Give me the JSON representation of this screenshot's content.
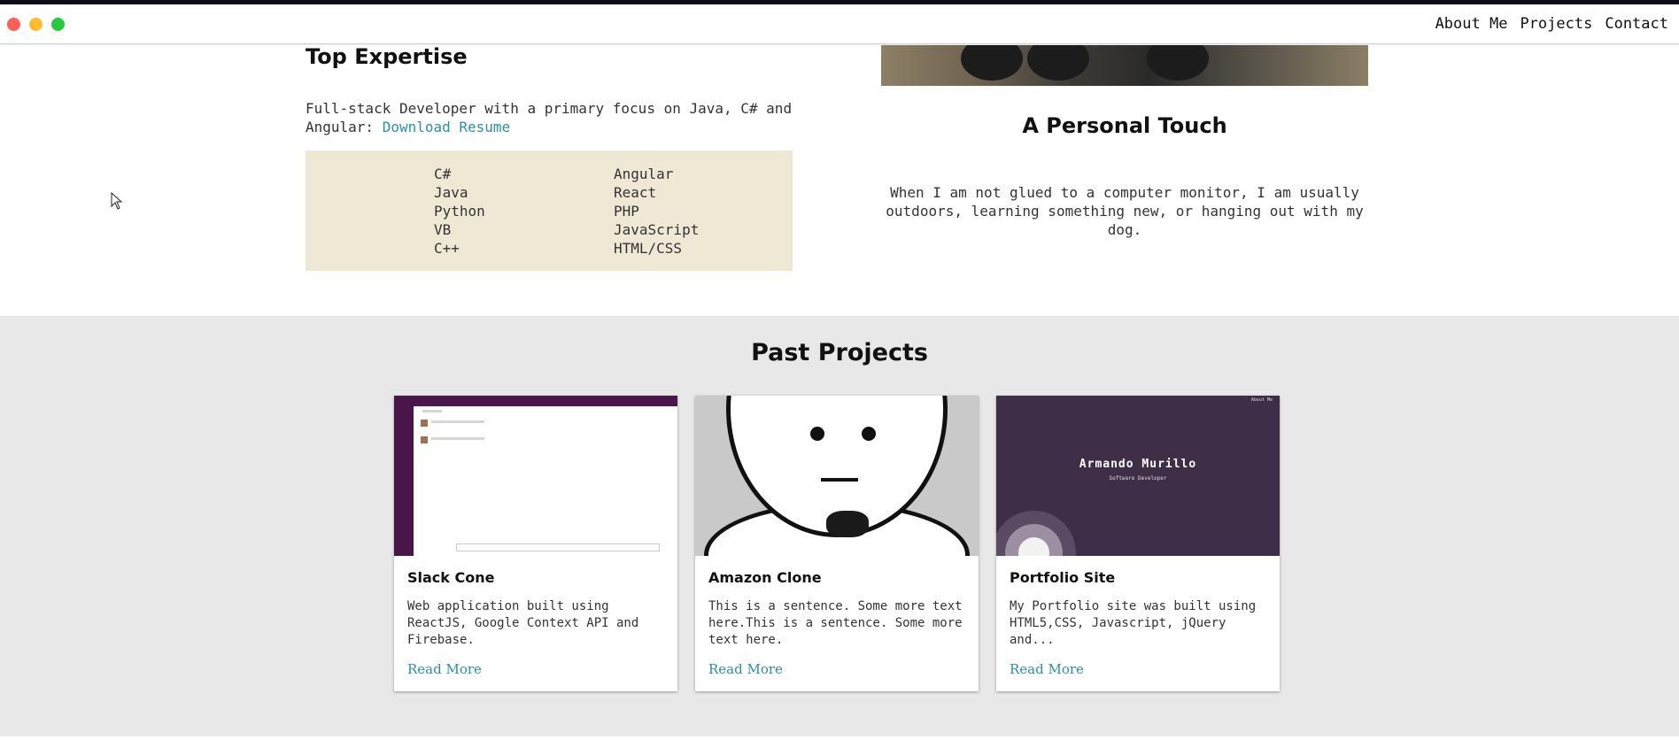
{
  "nav": {
    "links": [
      "About Me",
      "Projects",
      "Contact"
    ]
  },
  "expertise": {
    "title": "Top Expertise",
    "description": "Full-stack Developer with a primary focus on Java, C# and Angular: ",
    "resume_link": "Download Resume",
    "skills_left": [
      "C#",
      "Java",
      "Python",
      "VB",
      "C++"
    ],
    "skills_right": [
      "Angular",
      "React",
      "PHP",
      "JavaScript",
      "HTML/CSS"
    ]
  },
  "personal": {
    "title": "A Personal Touch",
    "text": "When I am not glued to a computer monitor, I am usually outdoors, learning something new, or hanging out with my dog."
  },
  "projects": {
    "title": "Past Projects",
    "cards": [
      {
        "title": "Slack Cone",
        "description": "Web application built using ReactJS, Google Context API and Firebase.",
        "link": "Read More"
      },
      {
        "title": "Amazon Clone",
        "description": "This is a sentence. Some more text here.This is a sentence. Some more text here.",
        "link": "Read More"
      },
      {
        "title": "Portfolio Site",
        "description": "My Portfolio site was built using HTML5,CSS, Javascript, jQuery and...",
        "link": "Read More",
        "thumb_name": "Armando Murillo",
        "thumb_role": "Software Developer"
      }
    ]
  },
  "colors": {
    "link": "#2a8fa8",
    "skills_bg": "#efe8d5",
    "section_bg": "#e8e8e8",
    "slack_purple": "#4a154b",
    "portfolio_purple": "#3f2e48"
  }
}
